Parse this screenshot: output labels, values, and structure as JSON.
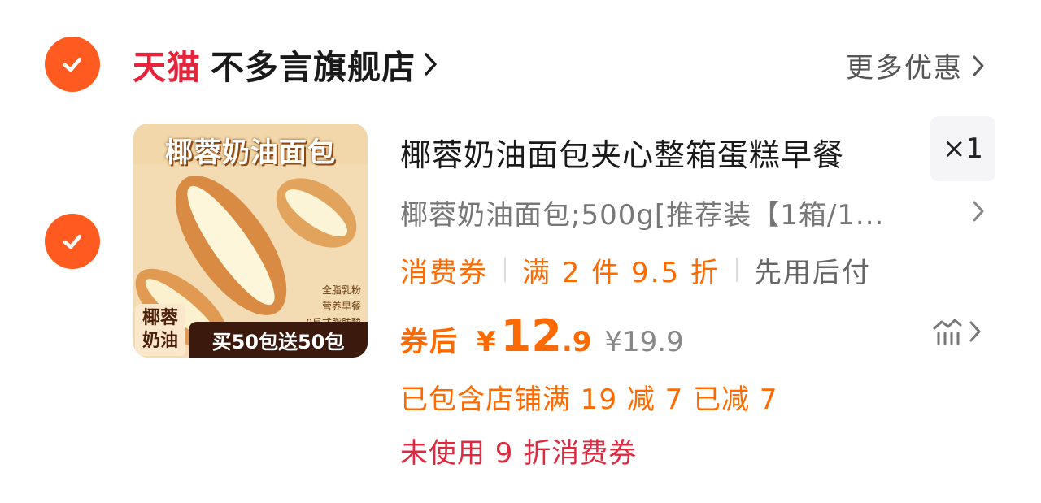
{
  "shop": {
    "platform": "天猫",
    "name": "不多言旗舰店",
    "more_deals": "更多优惠"
  },
  "product": {
    "image_text": {
      "title": "椰蓉奶油面包",
      "tags": [
        "全脂乳粉",
        "营养早餐",
        "0反式脂肪酸"
      ],
      "badge_left": "椰蓉\n奶油",
      "badge_right": "买50包送50包"
    },
    "title": "椰蓉奶油面包夹心整箱蛋糕早餐",
    "quantity": "×1",
    "sku": "椰蓉奶油面包;500g[推荐装【1箱/1...",
    "tags": [
      {
        "label": "消费券",
        "style": "orange"
      },
      {
        "label": "满 2 件 9.5 折",
        "style": "orange"
      },
      {
        "label": "先用后付",
        "style": "gray"
      }
    ],
    "price": {
      "label": "券后",
      "currency": "¥",
      "integer": "12",
      "decimal": ".9",
      "original": "¥19.9"
    },
    "promo_applied": "已包含店铺满 19 减 7 已减 7",
    "promo_unused": "未使用 9 折消费券"
  },
  "colors": {
    "accent": "#ff5a1f",
    "tmall_red": "#e8233c",
    "price_orange": "#ff6a00",
    "coupon_red": "#e0293f"
  },
  "icons": {
    "select": "checkmark-icon",
    "chevron": "chevron-right-icon",
    "price_chart": "price-trend-icon"
  }
}
